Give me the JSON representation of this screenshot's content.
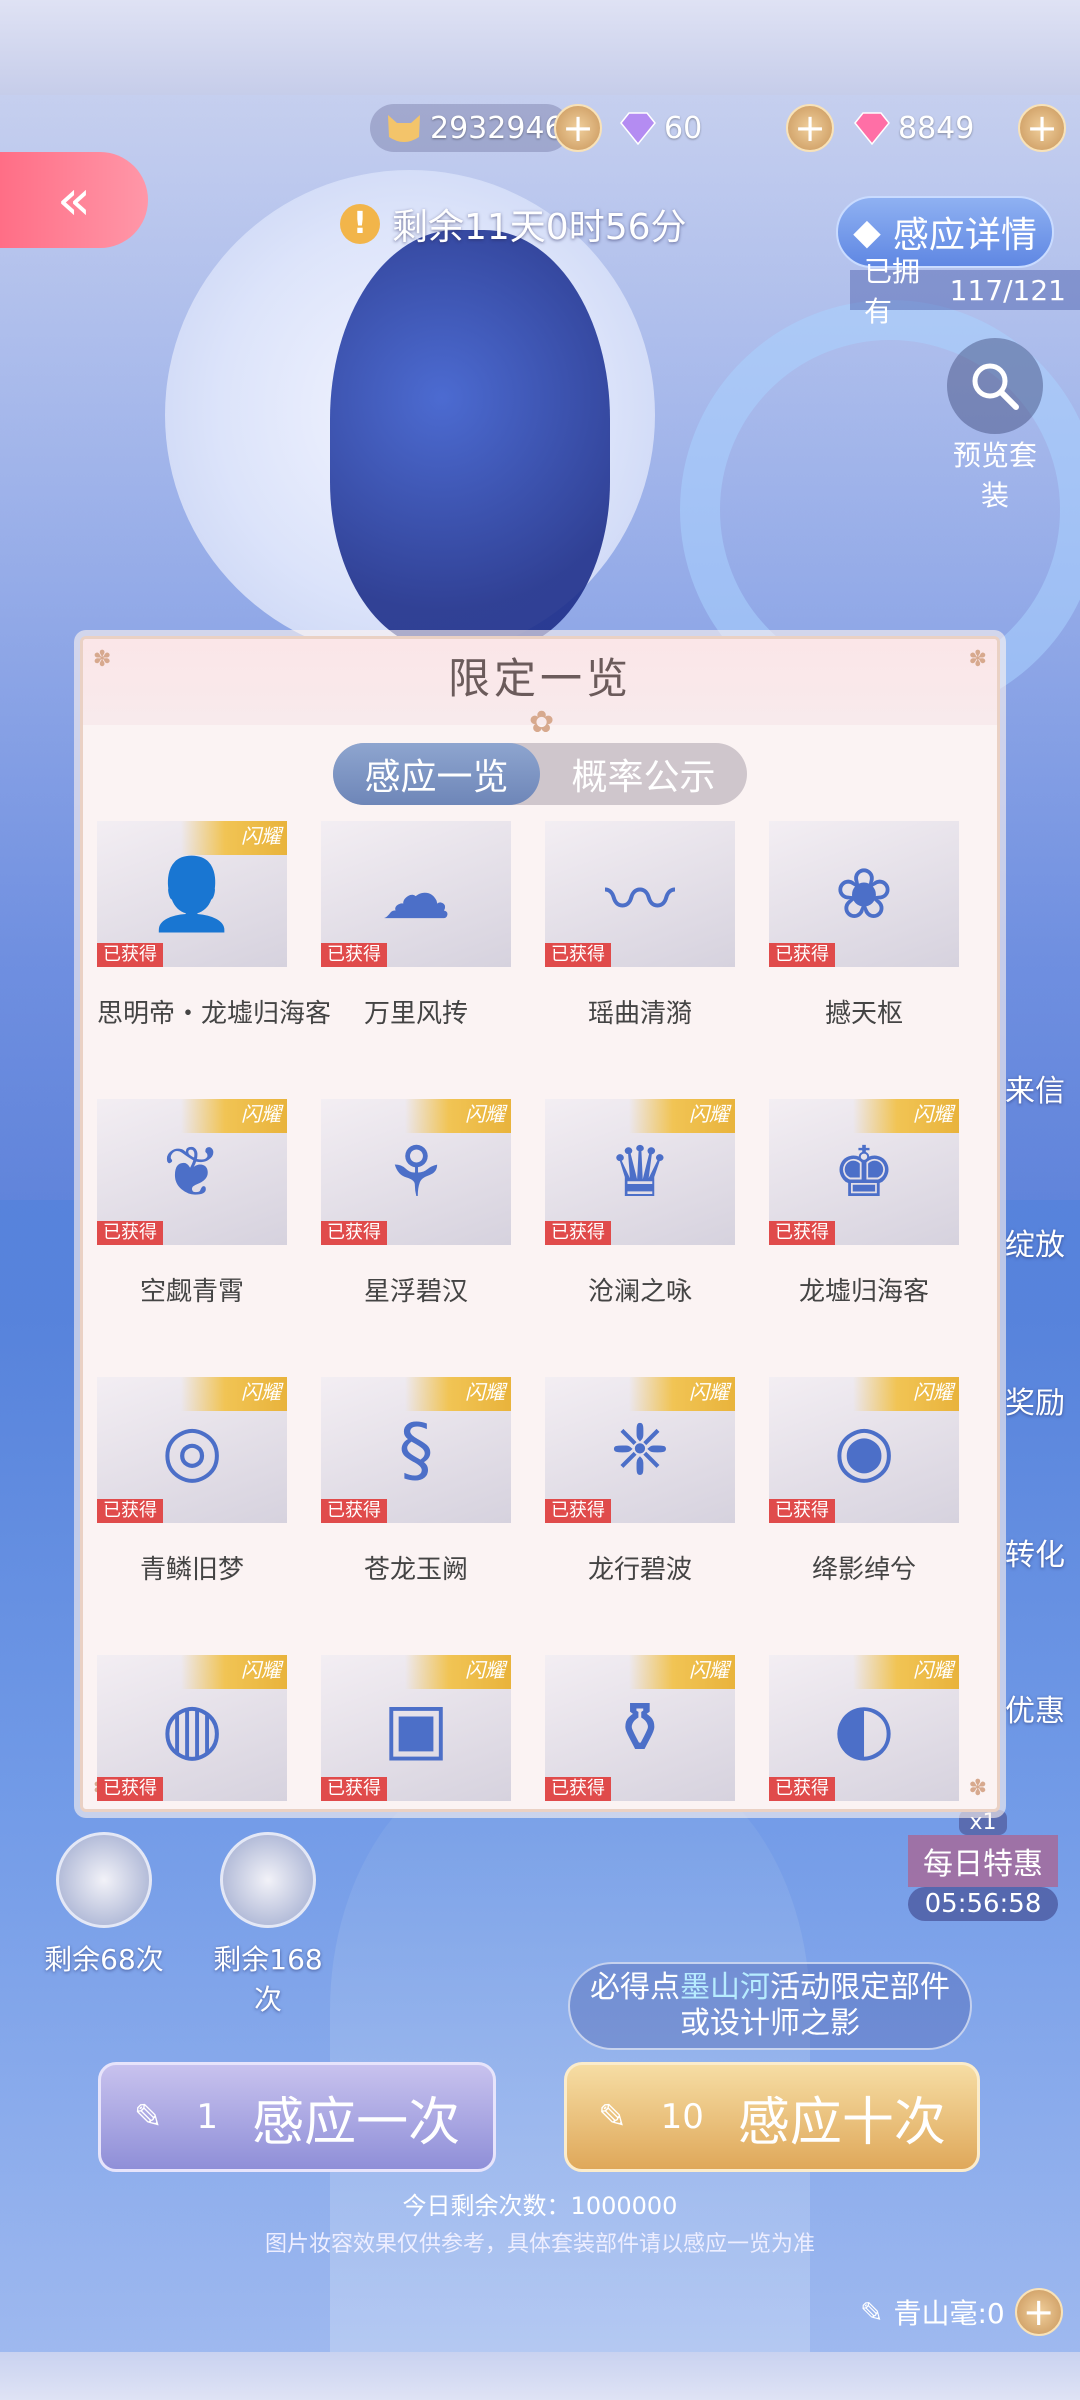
{
  "currency": {
    "coins": "29329469",
    "diamonds": "60",
    "gems": "8849"
  },
  "timer": "剩余11天0时56分",
  "detail_button": "感应详情",
  "owned": {
    "prefix": "已拥有",
    "count": "117/121"
  },
  "preview_label": "预览套装",
  "side_menu": [
    "来信",
    "绽放",
    "奖励",
    "转化",
    "优惠"
  ],
  "daily_deal": {
    "count": "x1",
    "label": "每日特惠",
    "time": "05:56:58"
  },
  "modal": {
    "title": "限定一览",
    "tabs": [
      {
        "label": "感应一览",
        "active": true
      },
      {
        "label": "概率公示",
        "active": false
      }
    ],
    "items": [
      {
        "name": "思明帝・龙墟归海客",
        "badge": "已获得",
        "ribbon": "闪耀",
        "icon": "portrait-icon"
      },
      {
        "name": "万里风抟",
        "badge": "已获得",
        "ribbon": "",
        "icon": "hairstyle-icon"
      },
      {
        "name": "瑶曲清漪",
        "badge": "已获得",
        "ribbon": "",
        "icon": "dragon-ribbon-icon"
      },
      {
        "name": "撼天枢",
        "badge": "已获得",
        "ribbon": "",
        "icon": "earrings-icon"
      },
      {
        "name": "空觑青霄",
        "badge": "已获得",
        "ribbon": "闪耀",
        "icon": "wings-icon"
      },
      {
        "name": "星浮碧汉",
        "badge": "已获得",
        "ribbon": "闪耀",
        "icon": "necklace-icon"
      },
      {
        "name": "沧澜之咏",
        "badge": "已获得",
        "ribbon": "闪耀",
        "icon": "dress-icon"
      },
      {
        "name": "龙墟归海客",
        "badge": "已获得",
        "ribbon": "闪耀",
        "icon": "robe-icon"
      },
      {
        "name": "青鳞旧梦",
        "badge": "已获得",
        "ribbon": "闪耀",
        "icon": "bracelet-icon"
      },
      {
        "name": "苍龙玉阙",
        "badge": "已获得",
        "ribbon": "闪耀",
        "icon": "water-dragon-icon"
      },
      {
        "name": "龙行碧波",
        "badge": "已获得",
        "ribbon": "闪耀",
        "icon": "tassel-icon"
      },
      {
        "name": "绛影绰兮",
        "badge": "已获得",
        "ribbon": "闪耀",
        "icon": "makeup-box-icon"
      },
      {
        "name": "",
        "badge": "已获得",
        "ribbon": "闪耀",
        "icon": "mirror-icon"
      },
      {
        "name": "",
        "badge": "已获得",
        "ribbon": "闪耀",
        "icon": "vanity-icon"
      },
      {
        "name": "",
        "badge": "已获得",
        "ribbon": "闪耀",
        "icon": "perfume-icon"
      },
      {
        "name": "",
        "badge": "已获得",
        "ribbon": "闪耀",
        "icon": "compact-icon"
      }
    ]
  },
  "owners": [
    {
      "label": "剩余68次"
    },
    {
      "label": "剩余168次"
    }
  ],
  "notice": {
    "pre": "必得点",
    "highlight": "墨山河",
    "post": "活动限定部件",
    "line2": "或设计师之影"
  },
  "buttons": {
    "single": {
      "num": "1",
      "label": "感应一次"
    },
    "ten": {
      "num": "10",
      "label": "感应十次"
    }
  },
  "remaining_today": "今日剩余次数：1000000",
  "disclaimer": "图片妆容效果仅供参考，具体套装部件请以感应一览为准",
  "pen": "青山毫:0",
  "colors": {
    "accent_pink": "#ff6e86",
    "gold": "#e8b23a",
    "badge_red": "#e04b4b",
    "tab_blue": "#6e86b8"
  }
}
